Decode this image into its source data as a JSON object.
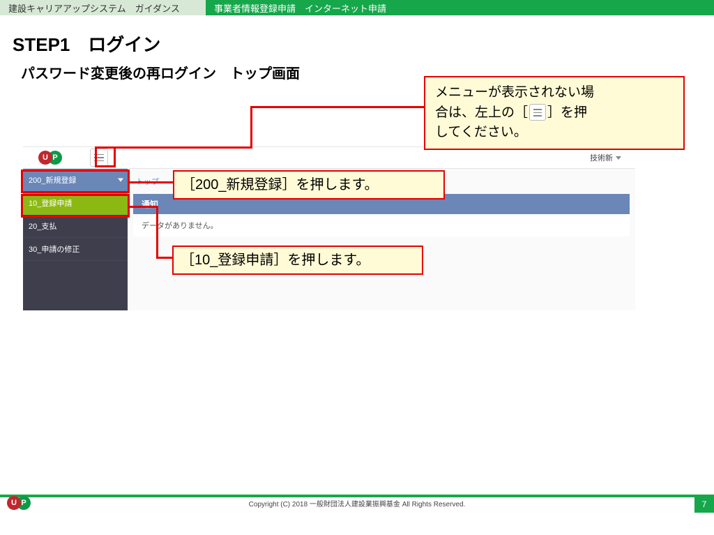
{
  "header": {
    "left": "建設キャリアアップシステム　ガイダンス",
    "right": "事業者情報登録申請　インターネット申請"
  },
  "step_title": "STEP1　ログイン",
  "subtitle": "パスワード変更後の再ログイン　トップ画面",
  "callouts": {
    "top_line1": "メニューが表示されない場",
    "top_line2_a": "合は、左上の［",
    "top_line2_b": "］を押",
    "top_line3": "してください。",
    "c200": "［200_新規登録］を押します。",
    "c10": "［10_登録申請］を押します。"
  },
  "ui": {
    "user_label": "技術新",
    "sidebar": [
      {
        "label": "200_新規登録"
      },
      {
        "label": "10_登録申請"
      },
      {
        "label": "20_支払"
      },
      {
        "label": "30_申請の修正"
      }
    ],
    "crumb": "トップ",
    "notice_header": "通知",
    "notice_body": "データがありません。"
  },
  "footer": {
    "copyright": "Copyright (C) 2018 一般財団法人建設業振興基金 All Rights Reserved.",
    "page": "7"
  }
}
